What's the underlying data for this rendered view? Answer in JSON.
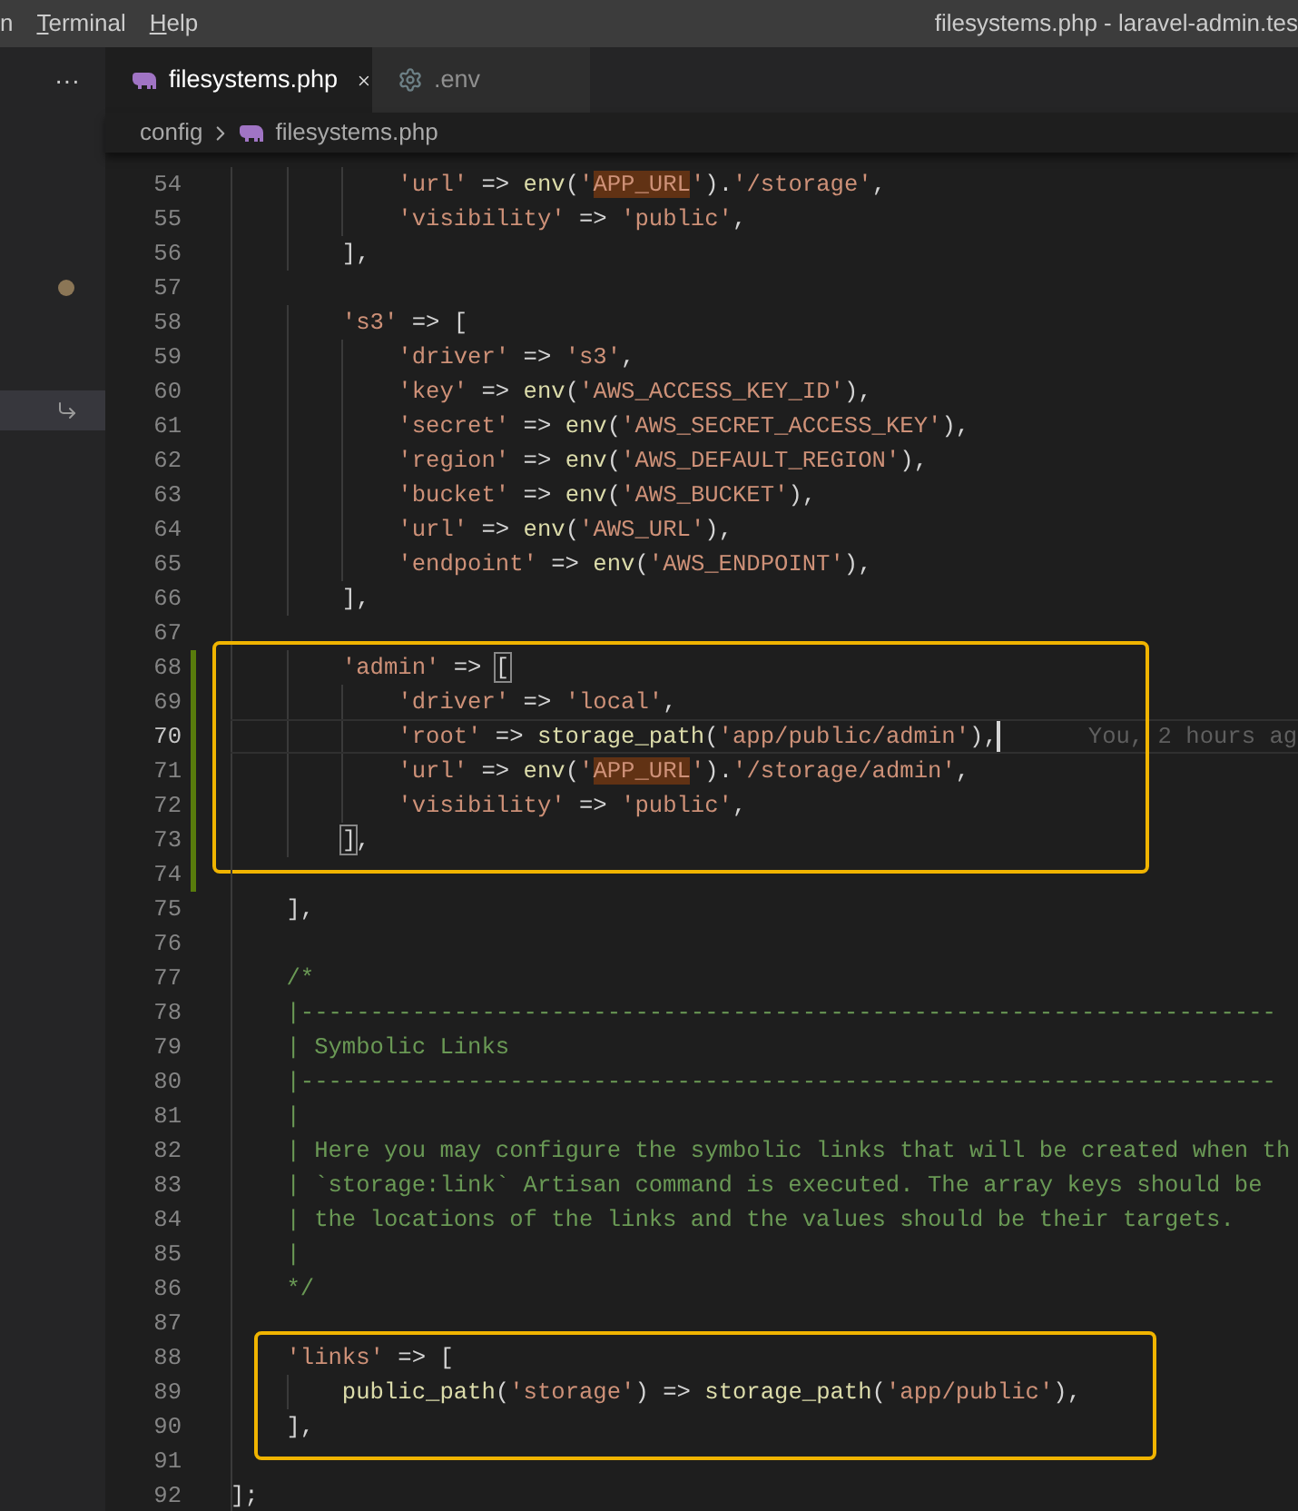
{
  "title_bar": {
    "menu": [
      {
        "label": "n",
        "mnemonic": false
      },
      {
        "label": "Terminal",
        "mnemonic": true
      },
      {
        "label": "Help",
        "mnemonic": true
      }
    ],
    "title": "filesystems.php - laravel-admin.tes"
  },
  "sidebar": {
    "more": "···",
    "items": [
      {
        "kind": "dot",
        "color": "#8b7656",
        "selected": false
      },
      {
        "kind": "subitem",
        "selected": true
      }
    ]
  },
  "tabs": [
    {
      "label": "filesystems.php",
      "selected": true
    },
    {
      "label": ".env",
      "selected": false
    }
  ],
  "breadcrumb": [
    {
      "label": "config"
    },
    {
      "label": "filesystems.php"
    }
  ],
  "editor": {
    "blocks": [
      {
        "callout": false,
        "lines": [
          {
            "number": "54",
            "modified": false,
            "current": false,
            "tokens": [
              {
                "kind": "string",
                "text": "            'url'"
              },
              {
                "kind": "plain",
                "text": " => "
              },
              {
                "kind": "function",
                "text": "env"
              },
              {
                "kind": "plain",
                "text": "("
              },
              {
                "kind": "string",
                "text": "'"
              },
              {
                "kind": "match",
                "text": "APP_URL"
              },
              {
                "kind": "string",
                "text": "'"
              },
              {
                "kind": "plain",
                "text": ")."
              },
              {
                "kind": "string",
                "text": "'/storage'"
              },
              {
                "kind": "plain",
                "text": ","
              }
            ]
          },
          {
            "number": "55",
            "modified": false,
            "current": false,
            "tokens": [
              {
                "kind": "string",
                "text": "            'visibility'"
              },
              {
                "kind": "plain",
                "text": " => "
              },
              {
                "kind": "string",
                "text": "'public'"
              },
              {
                "kind": "plain",
                "text": ","
              }
            ]
          },
          {
            "number": "56",
            "modified": false,
            "current": false,
            "tokens": [
              {
                "kind": "plain",
                "text": "        ],"
              }
            ]
          },
          {
            "number": "57",
            "modified": false,
            "current": false
          },
          {
            "number": "58",
            "modified": false,
            "current": false,
            "tokens": [
              {
                "kind": "string",
                "text": "        's3'"
              },
              {
                "kind": "plain",
                "text": " => ["
              }
            ]
          },
          {
            "number": "59",
            "modified": false,
            "current": false,
            "tokens": [
              {
                "kind": "string",
                "text": "            'driver'"
              },
              {
                "kind": "plain",
                "text": " => "
              },
              {
                "kind": "string",
                "text": "'s3'"
              },
              {
                "kind": "plain",
                "text": ","
              }
            ]
          },
          {
            "number": "60",
            "modified": false,
            "current": false,
            "tokens": [
              {
                "kind": "string",
                "text": "            'key'"
              },
              {
                "kind": "plain",
                "text": " => "
              },
              {
                "kind": "function",
                "text": "env"
              },
              {
                "kind": "plain",
                "text": "("
              },
              {
                "kind": "string",
                "text": "'AWS_ACCESS_KEY_ID'"
              },
              {
                "kind": "plain",
                "text": "),"
              }
            ]
          },
          {
            "number": "61",
            "modified": false,
            "current": false,
            "tokens": [
              {
                "kind": "string",
                "text": "            'secret'"
              },
              {
                "kind": "plain",
                "text": " => "
              },
              {
                "kind": "function",
                "text": "env"
              },
              {
                "kind": "plain",
                "text": "("
              },
              {
                "kind": "string",
                "text": "'AWS_SECRET_ACCESS_KEY'"
              },
              {
                "kind": "plain",
                "text": "),"
              }
            ]
          },
          {
            "number": "62",
            "modified": false,
            "current": false,
            "tokens": [
              {
                "kind": "string",
                "text": "            'region'"
              },
              {
                "kind": "plain",
                "text": " => "
              },
              {
                "kind": "function",
                "text": "env"
              },
              {
                "kind": "plain",
                "text": "("
              },
              {
                "kind": "string",
                "text": "'AWS_DEFAULT_REGION'"
              },
              {
                "kind": "plain",
                "text": "),"
              }
            ]
          },
          {
            "number": "63",
            "modified": false,
            "current": false,
            "tokens": [
              {
                "kind": "string",
                "text": "            'bucket'"
              },
              {
                "kind": "plain",
                "text": " => "
              },
              {
                "kind": "function",
                "text": "env"
              },
              {
                "kind": "plain",
                "text": "("
              },
              {
                "kind": "string",
                "text": "'AWS_BUCKET'"
              },
              {
                "kind": "plain",
                "text": "),"
              }
            ]
          },
          {
            "number": "64",
            "modified": false,
            "current": false,
            "tokens": [
              {
                "kind": "string",
                "text": "            'url'"
              },
              {
                "kind": "plain",
                "text": " => "
              },
              {
                "kind": "function",
                "text": "env"
              },
              {
                "kind": "plain",
                "text": "("
              },
              {
                "kind": "string",
                "text": "'AWS_URL'"
              },
              {
                "kind": "plain",
                "text": "),"
              }
            ]
          },
          {
            "number": "65",
            "modified": false,
            "current": false,
            "tokens": [
              {
                "kind": "string",
                "text": "            'endpoint'"
              },
              {
                "kind": "plain",
                "text": " => "
              },
              {
                "kind": "function",
                "text": "env"
              },
              {
                "kind": "plain",
                "text": "("
              },
              {
                "kind": "string",
                "text": "'AWS_ENDPOINT'"
              },
              {
                "kind": "plain",
                "text": "),"
              }
            ]
          },
          {
            "number": "66",
            "modified": false,
            "current": false,
            "tokens": [
              {
                "kind": "plain",
                "text": "        ],"
              }
            ]
          },
          {
            "number": "67",
            "modified": false,
            "current": false
          }
        ]
      },
      {
        "callout": true,
        "lines": [
          {
            "number": "68",
            "modified": true,
            "current": false,
            "tokens": [
              {
                "kind": "string",
                "text": "        'admin'"
              },
              {
                "kind": "plain",
                "text": " => "
              },
              {
                "kind": "bracket",
                "text": "["
              }
            ]
          },
          {
            "number": "69",
            "modified": true,
            "current": false,
            "tokens": [
              {
                "kind": "string",
                "text": "            'driver'"
              },
              {
                "kind": "plain",
                "text": " => "
              },
              {
                "kind": "string",
                "text": "'local'"
              },
              {
                "kind": "plain",
                "text": ","
              }
            ]
          },
          {
            "number": "70",
            "modified": true,
            "current": true,
            "blame": "You, 2 hours ag",
            "tokens": [
              {
                "kind": "string",
                "text": "            'root'"
              },
              {
                "kind": "plain",
                "text": " => "
              },
              {
                "kind": "function",
                "text": "storage_path"
              },
              {
                "kind": "plain",
                "text": "("
              },
              {
                "kind": "string",
                "text": "'app/public/admin'"
              },
              {
                "kind": "plain",
                "text": "),"
              }
            ]
          },
          {
            "number": "71",
            "modified": true,
            "current": false,
            "tokens": [
              {
                "kind": "string",
                "text": "            'url'"
              },
              {
                "kind": "plain",
                "text": " => "
              },
              {
                "kind": "function",
                "text": "env"
              },
              {
                "kind": "plain",
                "text": "("
              },
              {
                "kind": "string",
                "text": "'"
              },
              {
                "kind": "match",
                "text": "APP_URL"
              },
              {
                "kind": "string",
                "text": "'"
              },
              {
                "kind": "plain",
                "text": ")."
              },
              {
                "kind": "string",
                "text": "'/storage/admin'"
              },
              {
                "kind": "plain",
                "text": ","
              }
            ]
          },
          {
            "number": "72",
            "modified": true,
            "current": false,
            "tokens": [
              {
                "kind": "string",
                "text": "            'visibility'"
              },
              {
                "kind": "plain",
                "text": " => "
              },
              {
                "kind": "string",
                "text": "'public'"
              },
              {
                "kind": "plain",
                "text": ","
              }
            ]
          },
          {
            "number": "73",
            "modified": true,
            "current": false,
            "tokens": [
              {
                "kind": "bracket",
                "text": "        ]"
              },
              {
                "kind": "plain",
                "text": ","
              }
            ]
          }
        ]
      },
      {
        "callout": false,
        "lines": [
          {
            "number": "74",
            "modified": true,
            "current": false
          },
          {
            "number": "75",
            "modified": false,
            "current": false,
            "tokens": [
              {
                "kind": "plain",
                "text": "    ],"
              }
            ]
          },
          {
            "number": "76",
            "modified": false,
            "current": false
          },
          {
            "number": "77",
            "modified": false,
            "current": false,
            "tokens": [
              {
                "kind": "comment",
                "text": "    /*"
              }
            ]
          },
          {
            "number": "78",
            "modified": false,
            "current": false,
            "tokens": [
              {
                "kind": "comment",
                "text": "    |----------------------------------------------------------------------"
              }
            ]
          },
          {
            "number": "79",
            "modified": false,
            "current": false,
            "tokens": [
              {
                "kind": "comment",
                "text": "    | Symbolic Links"
              }
            ]
          },
          {
            "number": "80",
            "modified": false,
            "current": false,
            "tokens": [
              {
                "kind": "comment",
                "text": "    |----------------------------------------------------------------------"
              }
            ]
          },
          {
            "number": "81",
            "modified": false,
            "current": false,
            "tokens": [
              {
                "kind": "comment",
                "text": "    |"
              }
            ]
          },
          {
            "number": "82",
            "modified": false,
            "current": false,
            "tokens": [
              {
                "kind": "comment",
                "text": "    | Here you may configure the symbolic links that will be created when th"
              }
            ]
          },
          {
            "number": "83",
            "modified": false,
            "current": false,
            "tokens": [
              {
                "kind": "comment",
                "text": "    | `storage:link` Artisan command is executed. The array keys should be"
              }
            ]
          },
          {
            "number": "84",
            "modified": false,
            "current": false,
            "tokens": [
              {
                "kind": "comment",
                "text": "    | the locations of the links and the values should be their targets."
              }
            ]
          },
          {
            "number": "85",
            "modified": false,
            "current": false,
            "tokens": [
              {
                "kind": "comment",
                "text": "    |"
              }
            ]
          },
          {
            "number": "86",
            "modified": false,
            "current": false,
            "tokens": [
              {
                "kind": "comment",
                "text": "    */"
              }
            ]
          },
          {
            "number": "87",
            "modified": false,
            "current": false
          }
        ]
      },
      {
        "callout": true,
        "lines": [
          {
            "number": "88",
            "modified": false,
            "current": false,
            "tokens": [
              {
                "kind": "string",
                "text": "    'links'"
              },
              {
                "kind": "plain",
                "text": " => ["
              }
            ]
          },
          {
            "number": "89",
            "modified": false,
            "current": false,
            "tokens": [
              {
                "kind": "function",
                "text": "        public_path"
              },
              {
                "kind": "plain",
                "text": "("
              },
              {
                "kind": "string",
                "text": "'storage'"
              },
              {
                "kind": "plain",
                "text": ") => "
              },
              {
                "kind": "function",
                "text": "storage_path"
              },
              {
                "kind": "plain",
                "text": "("
              },
              {
                "kind": "string",
                "text": "'app/public'"
              },
              {
                "kind": "plain",
                "text": "),"
              }
            ]
          },
          {
            "number": "90",
            "modified": false,
            "current": false,
            "tokens": [
              {
                "kind": "plain",
                "text": "    ],"
              }
            ]
          }
        ]
      },
      {
        "callout": false,
        "lines": [
          {
            "number": "91",
            "modified": false,
            "current": false
          },
          {
            "number": "92",
            "modified": false,
            "current": false,
            "tokens": [
              {
                "kind": "plain",
                "text": "];"
              }
            ]
          }
        ]
      }
    ]
  }
}
